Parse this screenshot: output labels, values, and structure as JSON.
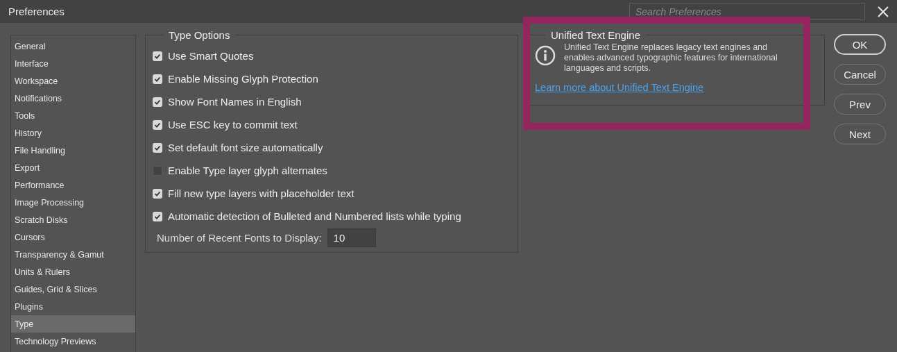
{
  "window": {
    "title": "Preferences",
    "search": {
      "placeholder": "Search Preferences"
    }
  },
  "sidebar": {
    "items": [
      {
        "label": "General",
        "selected": false
      },
      {
        "label": "Interface",
        "selected": false
      },
      {
        "label": "Workspace",
        "selected": false
      },
      {
        "label": "Notifications",
        "selected": false
      },
      {
        "label": "Tools",
        "selected": false
      },
      {
        "label": "History",
        "selected": false
      },
      {
        "label": "File Handling",
        "selected": false
      },
      {
        "label": "Export",
        "selected": false
      },
      {
        "label": "Performance",
        "selected": false
      },
      {
        "label": "Image Processing",
        "selected": false
      },
      {
        "label": "Scratch Disks",
        "selected": false
      },
      {
        "label": "Cursors",
        "selected": false
      },
      {
        "label": "Transparency & Gamut",
        "selected": false
      },
      {
        "label": "Units & Rulers",
        "selected": false
      },
      {
        "label": "Guides, Grid & Slices",
        "selected": false
      },
      {
        "label": "Plugins",
        "selected": false
      },
      {
        "label": "Type",
        "selected": true
      },
      {
        "label": "Technology Previews",
        "selected": false
      }
    ]
  },
  "type_options": {
    "title": "Type Options",
    "options": [
      {
        "label": "Use Smart Quotes",
        "checked": true
      },
      {
        "label": "Enable Missing Glyph Protection",
        "checked": true
      },
      {
        "label": "Show Font Names in English",
        "checked": true
      },
      {
        "label": "Use ESC key to commit text",
        "checked": true
      },
      {
        "label": "Set default font size automatically",
        "checked": true
      },
      {
        "label": "Enable Type layer glyph alternates",
        "checked": false
      },
      {
        "label": "Fill new type layers with placeholder text",
        "checked": true
      },
      {
        "label": "Automatic detection of Bulleted and Numbered lists while typing",
        "checked": true
      }
    ],
    "recent_fonts": {
      "label": "Number of Recent Fonts to Display:",
      "value": "10"
    }
  },
  "unified_text_engine": {
    "title": "Unified Text Engine",
    "description": "Unified Text Engine replaces legacy text engines and enables advanced typographic features for international languages and scripts.",
    "link": "Learn more about Unified Text Engine",
    "highlighted": true
  },
  "buttons": [
    "OK",
    "Cancel",
    "Prev",
    "Next"
  ]
}
